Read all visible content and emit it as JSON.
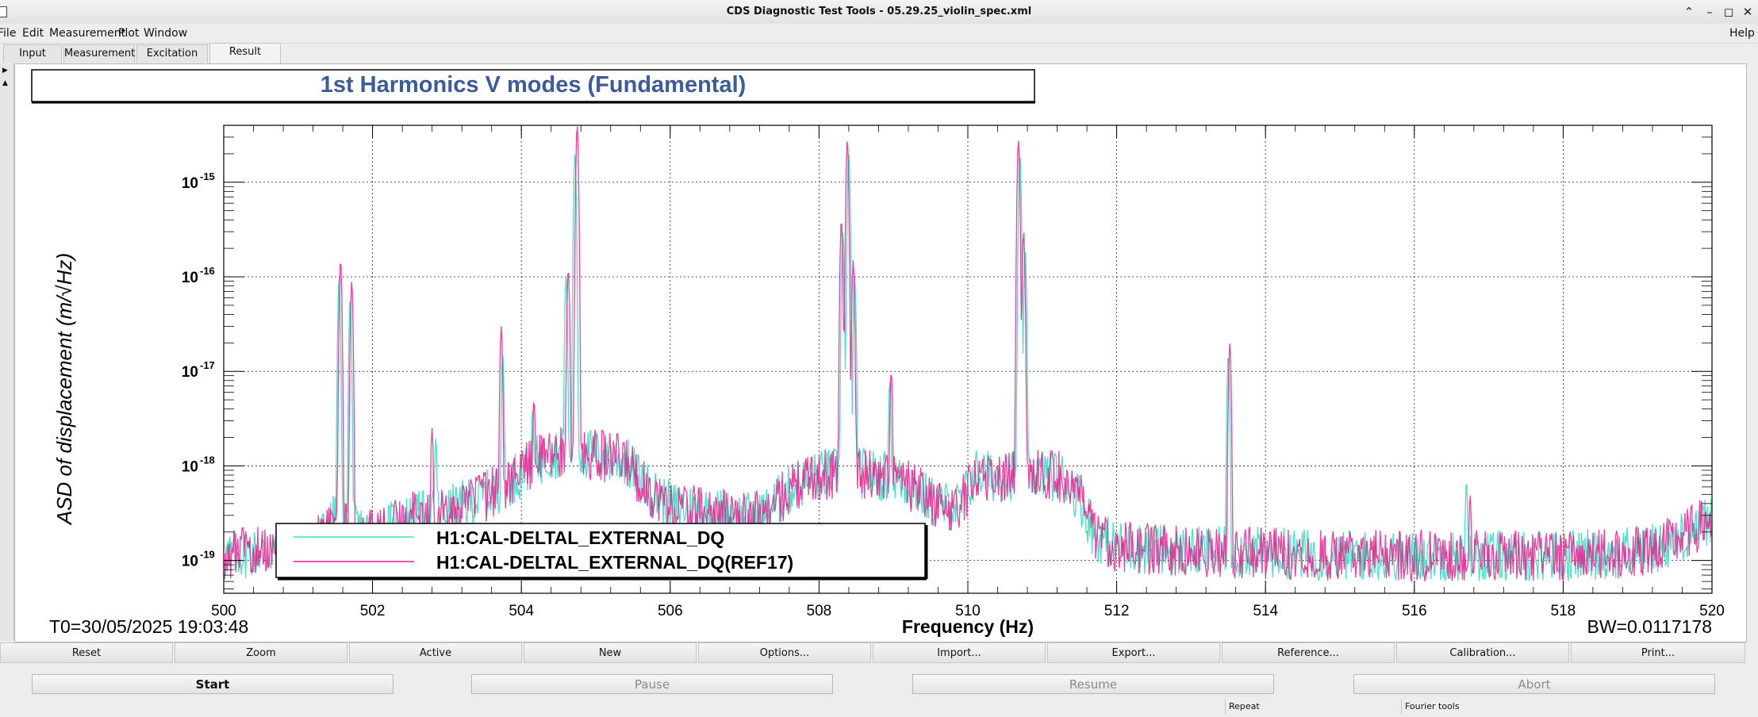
{
  "window": {
    "title": "CDS Diagnostic Test Tools - 05.29.25_violin_spec.xml",
    "controls": [
      "chevron-up-icon",
      "minimize-icon",
      "maximize-icon",
      "close-icon"
    ]
  },
  "menu": {
    "items": [
      "File",
      "Edit",
      "Measurement",
      "Plot",
      "Window"
    ],
    "help": "Help"
  },
  "tabs": {
    "items": [
      "Input",
      "Measurement",
      "Excitation",
      "Result"
    ],
    "active": "Result"
  },
  "plot": {
    "info_left": "T0=30/05/2025 19:03:48",
    "info_right": "BW=0.0117178",
    "legend": [
      "H1:CAL-DELTAL_EXTERNAL_DQ",
      "H1:CAL-DELTAL_EXTERNAL_DQ(REF17)"
    ]
  },
  "chart_data": {
    "type": "line",
    "title": "1st Harmonics V modes (Fundamental)",
    "xlabel": "Frequency (Hz)",
    "ylabel": "ASD of displacement (m/√Hz)",
    "xlim": [
      500,
      520
    ],
    "ylim": [
      4.5e-20,
      4e-15
    ],
    "yscale": "log",
    "grid": true,
    "legend_position": "bottom-left",
    "xticks": [
      "500",
      "502",
      "504",
      "506",
      "508",
      "510",
      "512",
      "514",
      "516",
      "518",
      "520"
    ],
    "yticks": [
      {
        "exp": "-15",
        "value": 1e-15
      },
      {
        "exp": "-16",
        "value": 1e-16
      },
      {
        "exp": "-17",
        "value": 1e-17
      },
      {
        "exp": "-18",
        "value": 1e-18
      },
      {
        "exp": "-19",
        "value": 1e-19
      }
    ],
    "background_envelope": [
      [
        500.0,
        1.2e-19
      ],
      [
        500.4,
        1.3e-19
      ],
      [
        500.8,
        1.3e-19
      ],
      [
        501.2,
        1.5e-19
      ],
      [
        501.5,
        3e-19
      ],
      [
        502.0,
        2e-19
      ],
      [
        502.5,
        3e-19
      ],
      [
        503.0,
        3.5e-19
      ],
      [
        503.5,
        5e-19
      ],
      [
        503.9,
        8e-19
      ],
      [
        504.2,
        1.2e-18
      ],
      [
        504.5,
        1.5e-18
      ],
      [
        505.0,
        1.4e-18
      ],
      [
        505.4,
        1.2e-18
      ],
      [
        505.7,
        6e-19
      ],
      [
        506.0,
        4e-19
      ],
      [
        506.5,
        3.5e-19
      ],
      [
        507.0,
        3e-19
      ],
      [
        507.3,
        3.5e-19
      ],
      [
        507.6,
        6e-19
      ],
      [
        507.9,
        8e-19
      ],
      [
        508.2,
        9e-19
      ],
      [
        508.6,
        9e-19
      ],
      [
        509.0,
        8e-19
      ],
      [
        509.3,
        6e-19
      ],
      [
        509.6,
        4e-19
      ],
      [
        509.9,
        4e-19
      ],
      [
        510.1,
        9e-19
      ],
      [
        510.4,
        8e-19
      ],
      [
        510.7,
        9e-19
      ],
      [
        511.0,
        9e-19
      ],
      [
        511.3,
        8e-19
      ],
      [
        511.5,
        5e-19
      ],
      [
        511.7,
        2e-19
      ],
      [
        512.0,
        1.5e-19
      ],
      [
        513.0,
        1.3e-19
      ],
      [
        514.0,
        1.3e-19
      ],
      [
        515.0,
        1.2e-19
      ],
      [
        516.0,
        1.2e-19
      ],
      [
        517.0,
        1.2e-19
      ],
      [
        518.0,
        1.2e-19
      ],
      [
        519.0,
        1.3e-19
      ],
      [
        519.5,
        1.7e-19
      ],
      [
        520.0,
        3e-19
      ]
    ],
    "series": [
      {
        "name": "H1:CAL-DELTAL_EXTERNAL_DQ",
        "color": "#3de0c4",
        "peaks": [
          [
            501.55,
            1e-16
          ],
          [
            501.7,
            6e-17
          ],
          [
            502.85,
            2e-18
          ],
          [
            503.75,
            1.5e-17
          ],
          [
            504.15,
            4e-18
          ],
          [
            504.6,
            1e-16
          ],
          [
            504.72,
            2e-15
          ],
          [
            508.32,
            3e-16
          ],
          [
            508.4,
            2e-15
          ],
          [
            508.48,
            1e-16
          ],
          [
            508.95,
            8e-18
          ],
          [
            510.7,
            2e-15
          ],
          [
            510.77,
            2e-16
          ],
          [
            513.5,
            1.5e-17
          ],
          [
            516.7,
            7e-19
          ]
        ]
      },
      {
        "name": "H1:CAL-DELTAL_EXTERNAL_DQ(REF17)",
        "color": "#ee1d8e",
        "peaks": [
          [
            501.57,
            1.5e-16
          ],
          [
            501.72,
            9e-17
          ],
          [
            502.8,
            2.5e-18
          ],
          [
            503.73,
            3e-17
          ],
          [
            504.17,
            5e-18
          ],
          [
            504.63,
            1.2e-16
          ],
          [
            504.75,
            4e-15
          ],
          [
            508.3,
            4e-16
          ],
          [
            508.38,
            2.8e-15
          ],
          [
            508.46,
            1.5e-16
          ],
          [
            508.97,
            1e-17
          ],
          [
            510.68,
            2.8e-15
          ],
          [
            510.75,
            3e-16
          ],
          [
            513.52,
            2e-17
          ],
          [
            516.75,
            5e-19
          ]
        ]
      }
    ]
  },
  "buttons": {
    "row1": [
      "Reset",
      "Zoom",
      "Active",
      "New",
      "Options...",
      "Import...",
      "Export...",
      "Reference...",
      "Calibration...",
      "Print..."
    ],
    "start": "Start",
    "pause": "Pause",
    "resume": "Resume",
    "abort": "Abort"
  },
  "options": {
    "repeat": "Repeat",
    "fourier": "Fourier tools"
  }
}
